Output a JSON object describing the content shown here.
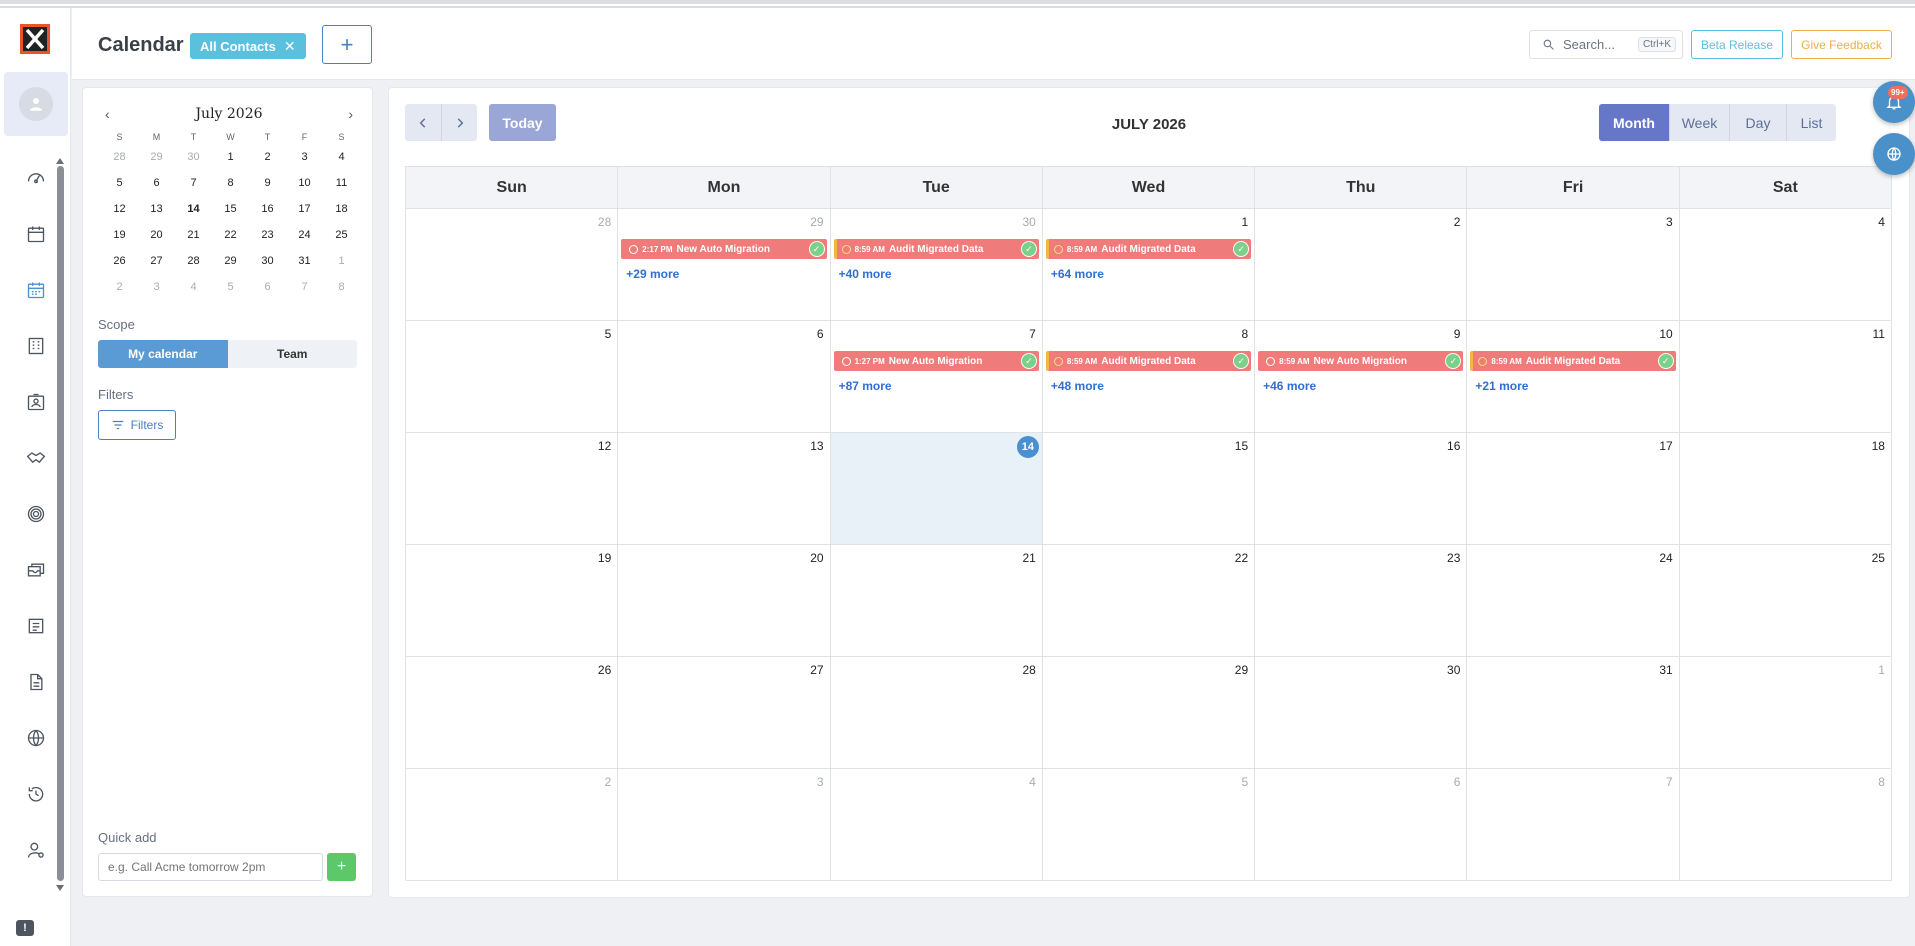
{
  "header": {
    "title": "Calendar",
    "chip_label": "All Contacts",
    "add_label": "+",
    "search_placeholder": "Search...",
    "search_shortcut": "Ctrl+K",
    "beta_label": "Beta Release",
    "feedback_label": "Give Feedback"
  },
  "sidebar": {
    "icons": [
      "dashboard-icon",
      "calendar-icon",
      "calendar-active-icon",
      "building-icon",
      "contact-card-icon",
      "handshake-icon",
      "target-icon",
      "inbox-icon",
      "form-icon",
      "document-icon",
      "globe-icon",
      "history-icon",
      "user-settings-icon"
    ]
  },
  "mini_calendar": {
    "title": "July 2026",
    "prev": "‹",
    "next": "›",
    "weekdays": [
      "S",
      "M",
      "T",
      "W",
      "T",
      "F",
      "S"
    ],
    "weeks": [
      [
        "28",
        "29",
        "30",
        "1",
        "2",
        "3",
        "4"
      ],
      [
        "5",
        "6",
        "7",
        "8",
        "9",
        "10",
        "11"
      ],
      [
        "12",
        "13",
        "14",
        "15",
        "16",
        "17",
        "18"
      ],
      [
        "19",
        "20",
        "21",
        "22",
        "23",
        "24",
        "25"
      ],
      [
        "26",
        "27",
        "28",
        "29",
        "30",
        "31",
        "1"
      ],
      [
        "2",
        "3",
        "4",
        "5",
        "6",
        "7",
        "8"
      ]
    ]
  },
  "scope": {
    "label": "Scope",
    "my_calendar": "My calendar",
    "team": "Team"
  },
  "filters": {
    "label": "Filters",
    "button": "Filters"
  },
  "quick_add": {
    "label": "Quick add",
    "placeholder": "e.g. Call Acme tomorrow 2pm",
    "button": "+"
  },
  "calendar": {
    "today_label": "Today",
    "month_title": "JULY 2026",
    "views": {
      "month": "Month",
      "week": "Week",
      "day": "Day",
      "list": "List"
    },
    "weekdays": [
      "Sun",
      "Mon",
      "Tue",
      "Wed",
      "Thu",
      "Fri",
      "Sat"
    ],
    "weeks": [
      [
        {
          "day": "28",
          "out": true
        },
        {
          "day": "29",
          "out": true,
          "event": {
            "time": "2:17 PM",
            "title": "New Auto Migration",
            "style": "red"
          },
          "more": "+29 more"
        },
        {
          "day": "30",
          "out": true,
          "event": {
            "time": "8:59 AM",
            "title": "Audit Migrated Data",
            "style": "amber"
          },
          "more": "+40 more"
        },
        {
          "day": "1",
          "event": {
            "time": "8:59 AM",
            "title": "Audit Migrated Data",
            "style": "amber"
          },
          "more": "+64 more"
        },
        {
          "day": "2"
        },
        {
          "day": "3"
        },
        {
          "day": "4"
        }
      ],
      [
        {
          "day": "5"
        },
        {
          "day": "6"
        },
        {
          "day": "7",
          "event": {
            "time": "1:27 PM",
            "title": "New Auto Migration",
            "style": "red"
          },
          "more": "+87 more"
        },
        {
          "day": "8",
          "event": {
            "time": "8:59 AM",
            "title": "Audit Migrated Data",
            "style": "amber"
          },
          "more": "+48 more"
        },
        {
          "day": "9",
          "event": {
            "time": "8:59 AM",
            "title": "New Auto Migration",
            "style": "red"
          },
          "more": "+46 more"
        },
        {
          "day": "10",
          "event": {
            "time": "8:59 AM",
            "title": "Audit Migrated Data",
            "style": "amber"
          },
          "more": "+21 more"
        },
        {
          "day": "11"
        }
      ],
      [
        {
          "day": "12"
        },
        {
          "day": "13"
        },
        {
          "day": "14",
          "today": true
        },
        {
          "day": "15"
        },
        {
          "day": "16"
        },
        {
          "day": "17"
        },
        {
          "day": "18"
        }
      ],
      [
        {
          "day": "19"
        },
        {
          "day": "20"
        },
        {
          "day": "21"
        },
        {
          "day": "22"
        },
        {
          "day": "23"
        },
        {
          "day": "24"
        },
        {
          "day": "25"
        }
      ],
      [
        {
          "day": "26"
        },
        {
          "day": "27"
        },
        {
          "day": "28"
        },
        {
          "day": "29"
        },
        {
          "day": "30"
        },
        {
          "day": "31"
        },
        {
          "day": "1",
          "out": true
        }
      ],
      [
        {
          "day": "2",
          "out": true
        },
        {
          "day": "3",
          "out": true
        },
        {
          "day": "4",
          "out": true
        },
        {
          "day": "5",
          "out": true
        },
        {
          "day": "6",
          "out": true
        },
        {
          "day": "7",
          "out": true
        },
        {
          "day": "8",
          "out": true
        }
      ]
    ]
  },
  "notifications": {
    "badge": "99+"
  },
  "colors": {
    "event_red": "#f07b7b",
    "event_amber_stripe": "#f3b640",
    "accent_blue": "#4a8fd0",
    "month_active": "#6777c8"
  }
}
